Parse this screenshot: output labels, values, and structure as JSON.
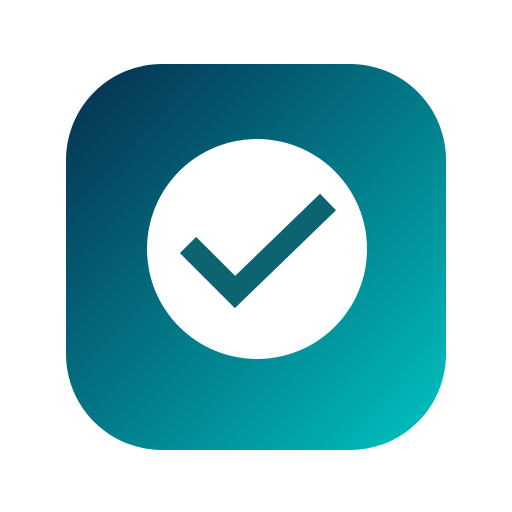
{
  "icon": {
    "name": "checkmark-app-icon",
    "symbol": "checkmark-icon",
    "colors": {
      "gradient_start": "#062d4e",
      "gradient_end": "#00c4c1",
      "circle": "#ffffff",
      "checkmark": "#0b6470"
    }
  }
}
